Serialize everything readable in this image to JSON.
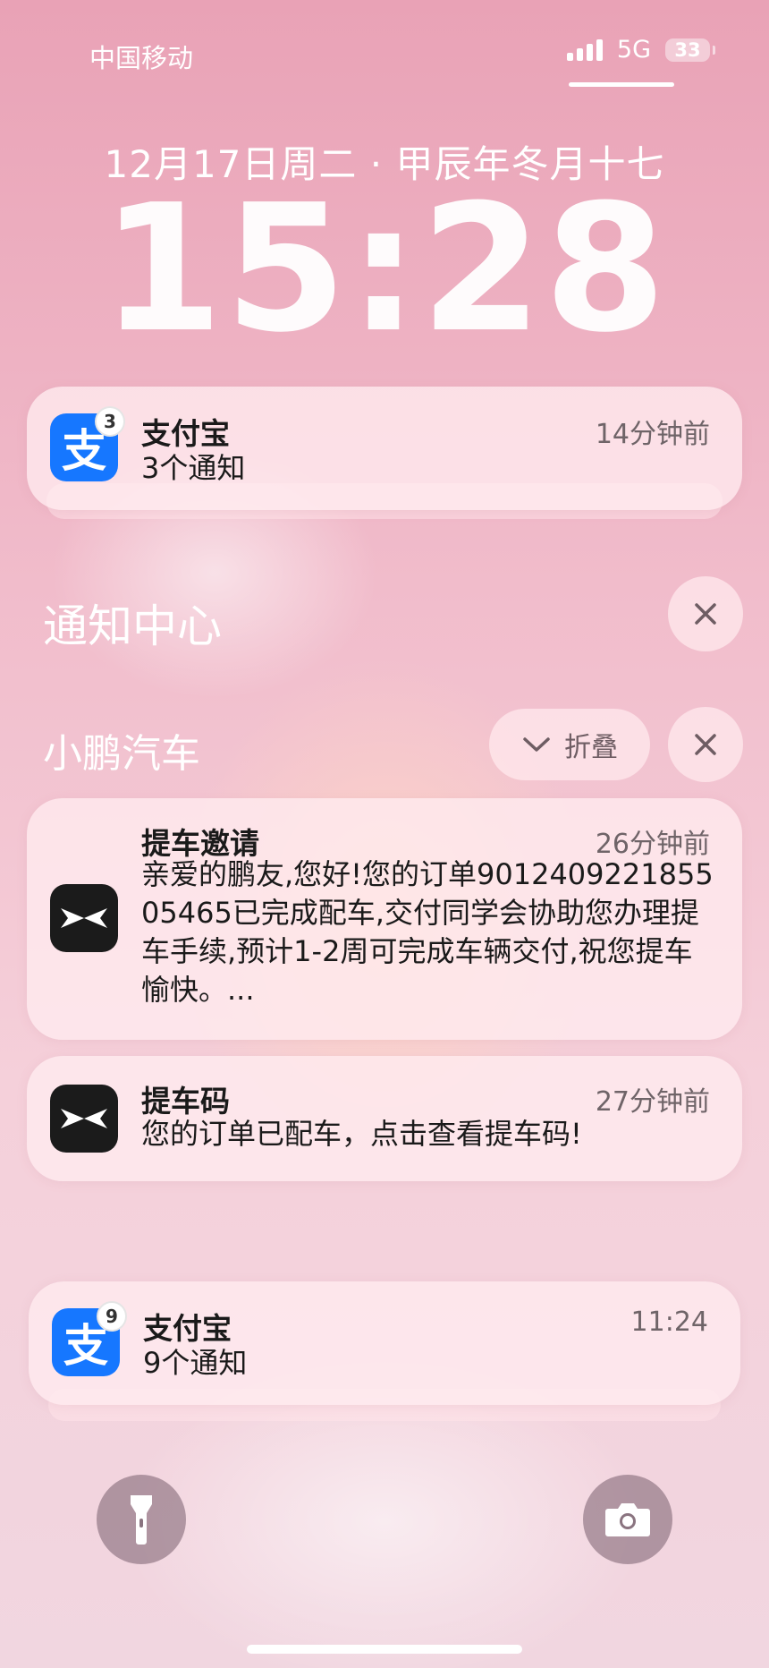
{
  "status_bar": {
    "carrier": "中国移动",
    "network": "5G",
    "battery": "33"
  },
  "lockscreen": {
    "date": "12月17日周二 · 甲辰年冬月十七",
    "time": "15:28"
  },
  "notification_alipay_top": {
    "app": "支付宝",
    "icon_glyph": "支",
    "badge": "3",
    "summary": "3个通知",
    "time": "14分钟前"
  },
  "notification_center": {
    "title": "通知中心"
  },
  "xpeng_group": {
    "title": "小鹏汽车",
    "collapse_label": "折叠",
    "notifications": [
      {
        "title": "提车邀请",
        "time": "26分钟前",
        "body": "亲爱的鹏友,您好!您的订单901240922185505465已完成配车,交付同学会协助您办理提车手续,预计1-2周可完成车辆交付,祝您提车愉快。..."
      },
      {
        "title": "提车码",
        "time": "27分钟前",
        "body": "您的订单已配车，点击查看提车码!"
      }
    ]
  },
  "notification_alipay_bottom": {
    "app": "支付宝",
    "icon_glyph": "支",
    "badge": "9",
    "summary": "9个通知",
    "time": "11:24"
  },
  "bottom_controls": {
    "flashlight_icon": "flashlight-icon",
    "camera_icon": "camera-icon"
  }
}
